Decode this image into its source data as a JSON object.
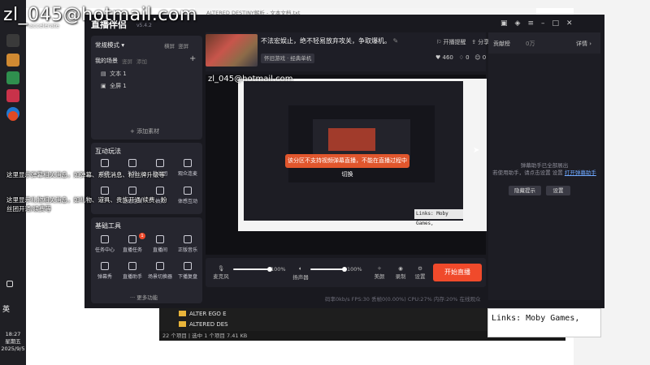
{
  "watermark": {
    "email": "zl_045@hotmail.com",
    "sub": ".accelerate",
    "preview_email": "zl_045@hotmail.com"
  },
  "explorer": {
    "title": "ALTERED DESTINY解析 - 文本文档.txt",
    "files": [
      "ALTER EGO E",
      "ALTERED DES"
    ],
    "status": "22 个项目 | 选中 1 个项目  7.41 KB"
  },
  "app": {
    "brand": "直播伴侣",
    "version": "v5.4.2",
    "mode": "常规模式",
    "mode_actions": [
      "横屏",
      "竖屏"
    ],
    "scene_tabs": [
      "我的场景",
      "竖屏",
      "添加"
    ],
    "materials": [
      "文本 1",
      "全屏 1"
    ],
    "add_material": "添加素材",
    "interaction_title": "互动玩法",
    "interaction_items": [
      "弹幕",
      "礼物",
      "粉丝团",
      "观众连麦",
      "PK",
      "主播连线",
      "抽奖",
      "体感互动"
    ],
    "tools_title": "基础工具",
    "tools_items": [
      "任务中心",
      "直播任务",
      "直播间",
      "正版音乐",
      "弹幕秀",
      "直播助手",
      "场景切换器",
      "下播复盘"
    ],
    "tools_badge": "1",
    "more": "更多功能",
    "stream_title": "不法宏娱止，绝不轻易放弃攻关，争取爆机。",
    "category": "怀旧游戏 · 经典单机",
    "stats": [
      "460",
      "0",
      "0"
    ],
    "top_actions": [
      "开播提醒",
      "分享"
    ],
    "toast": "该分区不支持视频弹幕直播，不能在直播过程中切换",
    "nested_links": "Links:  Moby Games,",
    "controls": {
      "mic_label": "麦克风",
      "mic_pct": "100%",
      "mic_level": 1.0,
      "speaker_label": "扬声器",
      "speaker_pct": "100%",
      "speaker_level": 1.0,
      "beauty": "美颜",
      "record": "录制",
      "settings": "设置"
    },
    "start_button": "开始直播",
    "status_line": "码率0kb/s    FPS:30    丢帧0(0.00%)    CPU:27%    内存:20%    在线观众",
    "right_panel": {
      "contribution": "贡献榜",
      "count": "0万",
      "details": "详情 ›",
      "barrage_tip": [
        "弹幕助手已全部展出",
        "若使用助手，请点击设置 设置"
      ],
      "open_helper_link": "打开弹幕助手",
      "btn_hide": "隐藏提示",
      "btn_settings": "设置"
    }
  },
  "overlay": {
    "barrage_msg": "这里显示弹幕相关消息，如弹幕、系统消息、粉丝牌升级等",
    "gift_msg": "这里显示礼物相关消息，如礼物、道具、贵族开通/续费、粉丝团开通/续费等"
  },
  "links_box": "Links:  Moby Games,",
  "taskbar": {
    "lang": "英",
    "time": "18:27",
    "weekday": "星期五",
    "date": "2025/9/5"
  },
  "colors": {
    "accent": "#f04a2b",
    "app_bg": "#19191f",
    "panel_bg": "#26262f"
  }
}
